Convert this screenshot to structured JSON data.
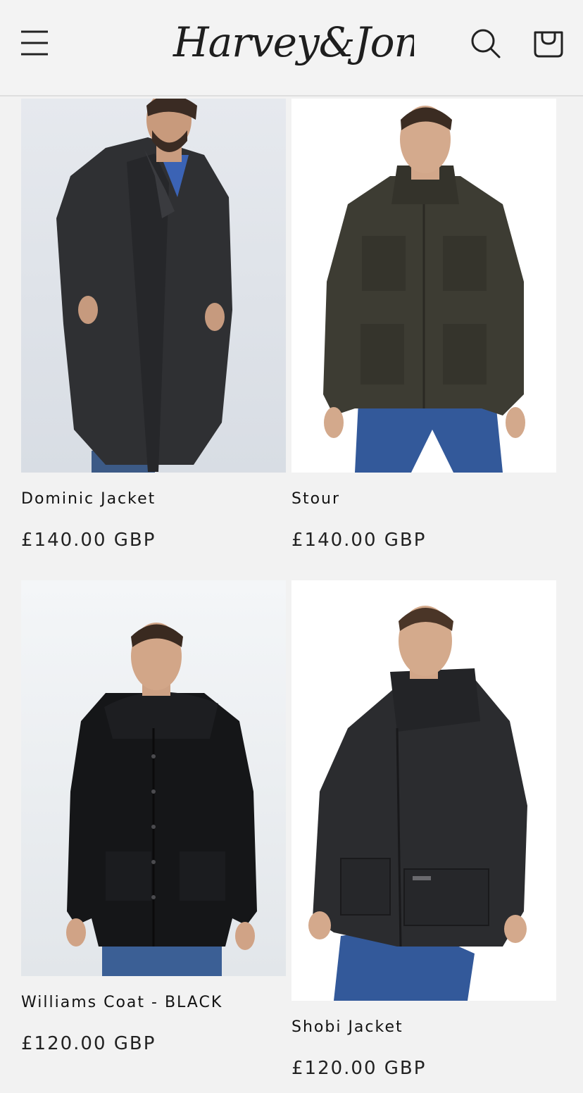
{
  "header": {
    "brand": "Harvey&Jones",
    "menu_icon": "hamburger-menu-icon",
    "search_icon": "search-icon",
    "cart_icon": "cart-icon"
  },
  "products": [
    {
      "title": "Dominic Jacket",
      "price": "£140.00 GBP",
      "image": "man-in-long-charcoal-overcoat"
    },
    {
      "title": "Stour",
      "price": "£140.00 GBP",
      "image": "man-in-olive-field-jacket"
    },
    {
      "title": "Williams Coat - BLACK",
      "price": "£120.00 GBP",
      "image": "man-in-black-hooded-parka"
    },
    {
      "title": "Shobi Jacket",
      "price": "£120.00 GBP",
      "image": "man-in-dark-grey-jacket"
    }
  ],
  "colors": {
    "page_bg": "#f2f2f2",
    "text": "#121212"
  }
}
